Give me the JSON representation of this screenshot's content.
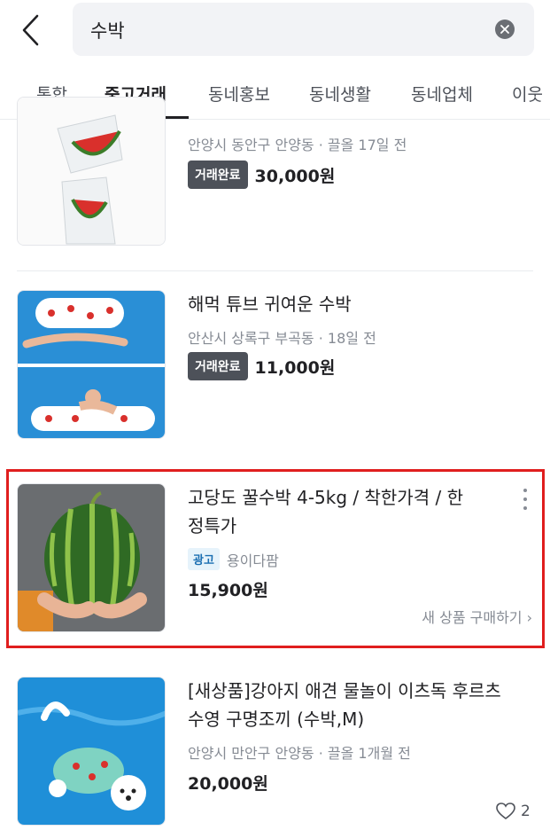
{
  "search": {
    "query": "수박"
  },
  "tabs": [
    {
      "label": "통합"
    },
    {
      "label": "중고거래"
    },
    {
      "label": "동네홍보"
    },
    {
      "label": "동네생활"
    },
    {
      "label": "동네업체"
    },
    {
      "label": "이웃"
    }
  ],
  "items": [
    {
      "location_time": "안양시 동안구 안양동 · 끌올 17일 전",
      "status": "거래완료",
      "price": "30,000원"
    },
    {
      "title": "해먹 튜브 귀여운 수박",
      "location_time": "안산시 상록구 부곡동 · 18일 전",
      "status": "거래완료",
      "price": "11,000원"
    },
    {
      "title_line1": "고당도 꿀수박 4-5kg / 착한가격 / 한",
      "title_line2": "정특가",
      "ad_label": "광고",
      "seller": "용이다팜",
      "price": "15,900원",
      "buy_link": "새 상품 구매하기 ›"
    },
    {
      "title_line1": "[새상품]강아지 애견 물놀이 이츠독 후르츠",
      "title_line2": "수영 구명조끼 (수박,M)",
      "location_time": "안양시 만안구 안양동 · 끌올 1개월 전",
      "price": "20,000원",
      "likes": "2"
    }
  ],
  "icons": [
    "back-arrow-icon",
    "clear-icon",
    "more-vertical-icon",
    "heart-icon"
  ],
  "colors": {
    "highlight": "#e01e1e",
    "badge_done": "#4d5159",
    "ad_badge": "#1b6fb2"
  }
}
